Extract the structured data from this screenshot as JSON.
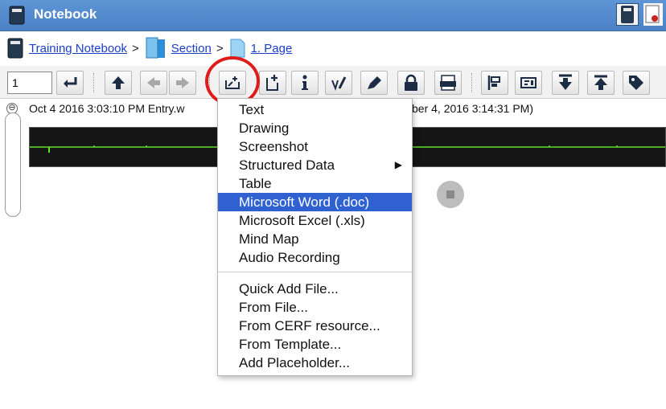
{
  "window": {
    "title": "Notebook"
  },
  "breadcrumb": {
    "notebook": "Training Notebook",
    "section": "Section",
    "page": "1. Page",
    "separator": ">"
  },
  "toolbar": {
    "page_number": "1",
    "buttons": [
      "enter-icon",
      "arrow-up-icon",
      "arrow-left-icon",
      "arrow-right-icon",
      "add-entry-icon",
      "add-page-icon",
      "info-icon",
      "sign-icon",
      "pen-icon",
      "lock-icon",
      "pdf-icon",
      "align-left-icon",
      "entry-card-icon",
      "move-down-icon",
      "move-up-icon",
      "tag-icon"
    ]
  },
  "entry": {
    "header_left": "Oct 4 2016 3:03:10 PM Entry.w",
    "header_right": "ber 4, 2016 3:14:31 PM)",
    "collapse_symbol": "⊖"
  },
  "menu": {
    "group1": [
      "Text",
      "Drawing",
      "Screenshot",
      "Structured Data",
      "Table",
      "Microsoft Word (.doc)",
      "Microsoft Excel (.xls)",
      "Mind Map",
      "Audio Recording"
    ],
    "group2": [
      "Quick Add File...",
      "From File...",
      "From CERF resource...",
      "From Template...",
      "Add Placeholder..."
    ],
    "selected": "Microsoft Word (.doc)",
    "submenu_item": "Structured Data"
  },
  "colors": {
    "titlebar": "#4b82c6",
    "selection": "#2f62d0",
    "link": "#1a3ec8",
    "highlight_ring": "#e01b1b",
    "waveform_line": "#5ee02a"
  }
}
